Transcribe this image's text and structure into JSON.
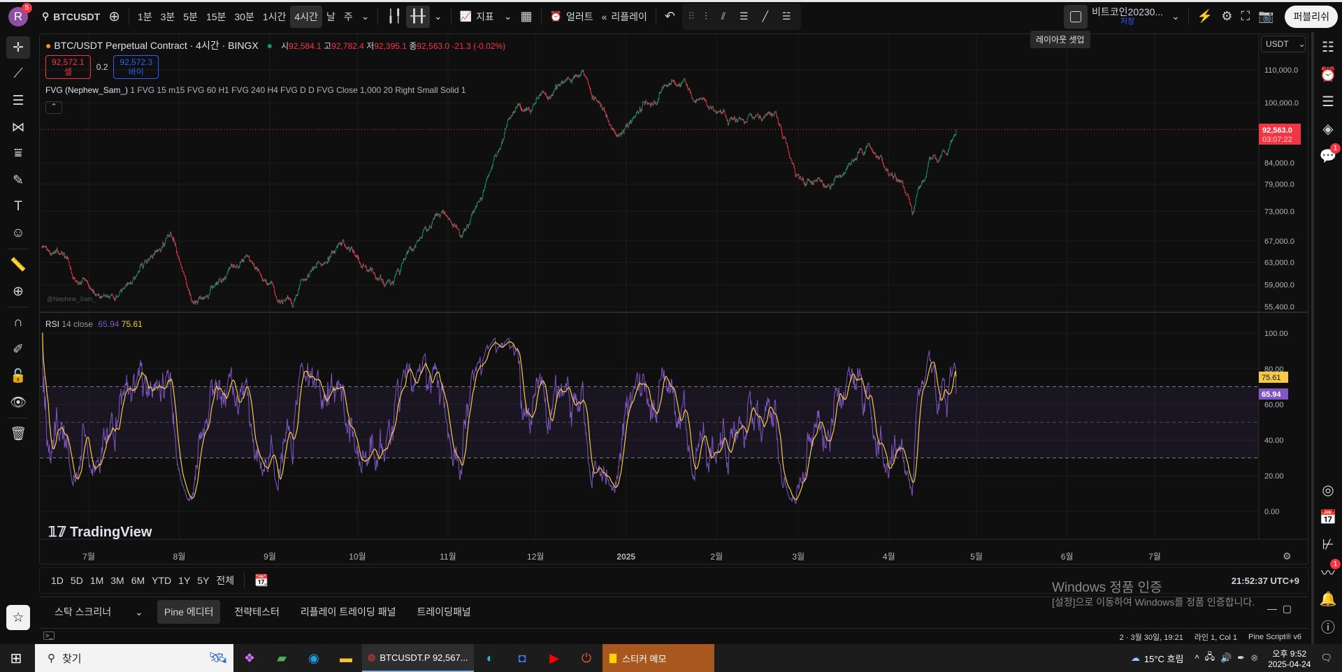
{
  "topbar": {
    "avatar_letter": "R",
    "avatar_badge": "5",
    "symbol": "BTCUSDT",
    "intervals": [
      "1분",
      "3분",
      "5분",
      "15분",
      "30분",
      "1시간",
      "4시간",
      "날",
      "주"
    ],
    "active_interval": "4시간",
    "indicators_label": "지표",
    "alert_label": "얼러트",
    "replay_label": "리플레이",
    "layout_name": "비트코인20230...",
    "layout_saved": "저장",
    "layout_tooltip": "레이아웃 셋업",
    "publish_label": "퍼블리쉬"
  },
  "legend": {
    "title": "BTC/USDT Perpetual Contract · 4시간 · BINGX",
    "open_label": "시",
    "open": "92,584.1",
    "high_label": "고",
    "high": "92,782.4",
    "low_label": "저",
    "low": "92,395.1",
    "close_label": "종",
    "close": "92,563.0",
    "change": "-21.3 (-0.02%)",
    "sell_price": "92,572.1",
    "sell_label": "셀",
    "spread": "0.2",
    "buy_price": "92,572.3",
    "buy_label": "바이",
    "indicator_name": "FVG (Nephew_Sam_)",
    "indicator_params": "1 FVG 15 m15 FVG 60 H1 FVG 240 H4 FVG D D FVG Close 1,000 20 Right Small Solid 1",
    "watermark_author": "@Nephew_Sam_",
    "rsi_name": "RSI",
    "rsi_params": "14 close",
    "rsi_value": "65.94",
    "rsi_ma_value": "75.61"
  },
  "price_axis": {
    "currency": "USDT",
    "last_price_label": "92,563.0",
    "countdown": "03:07:22"
  },
  "colors": {
    "up": "#089981",
    "down": "#f23645",
    "rsi": "#7e57c2",
    "rsi_ma": "#f7c948",
    "accent": "#2962ff"
  },
  "chart_data": {
    "type": "candlestick",
    "title": "BTC/USDT Perpetual Contract · 4시간 · BINGX",
    "price_scale": "log",
    "ylim": [
      55400,
      110000
    ],
    "price_ticks": [
      110000,
      100000,
      84000,
      79000,
      73000,
      67000,
      63000,
      59000,
      55400
    ],
    "price_tick_labels": [
      "110,000.0",
      "100,000.0",
      "84,000.0",
      "79,000.0",
      "73,000.0",
      "67,000.0",
      "63,000.0",
      "59,000.0",
      "55,400.0"
    ],
    "last_price": 92563.0,
    "approx_path": [
      [
        "2024-06-15",
        66000
      ],
      [
        "2024-07-06",
        55700
      ],
      [
        "2024-07-29",
        68800
      ],
      [
        "2024-08-06",
        55500
      ],
      [
        "2024-08-25",
        63900
      ],
      [
        "2024-09-06",
        55800
      ],
      [
        "2024-09-26",
        66000
      ],
      [
        "2024-10-11",
        60200
      ],
      [
        "2024-10-31",
        72300
      ],
      [
        "2024-11-06",
        68000
      ],
      [
        "2024-11-24",
        98600
      ],
      [
        "2024-12-17",
        107700
      ],
      [
        "2024-12-29",
        92700
      ],
      [
        "2025-01-21",
        107700
      ],
      [
        "2025-02-05",
        95200
      ],
      [
        "2025-02-21",
        97000
      ],
      [
        "2025-02-28",
        80000
      ],
      [
        "2025-03-11",
        78800
      ],
      [
        "2025-03-25",
        87200
      ],
      [
        "2025-04-09",
        75000
      ],
      [
        "2025-04-15",
        84800
      ],
      [
        "2025-04-21",
        85000
      ],
      [
        "2025-04-24",
        92563
      ]
    ],
    "x_ticks": [
      {
        "label": "7월",
        "date": "2024-07-01"
      },
      {
        "label": "8월",
        "date": "2024-08-01"
      },
      {
        "label": "9월",
        "date": "2024-09-01"
      },
      {
        "label": "10월",
        "date": "2024-10-01"
      },
      {
        "label": "11월",
        "date": "2024-11-01"
      },
      {
        "label": "12월",
        "date": "2024-12-01"
      },
      {
        "label": "2025",
        "date": "2025-01-01"
      },
      {
        "label": "2월",
        "date": "2025-02-01"
      },
      {
        "label": "3월",
        "date": "2025-03-01"
      },
      {
        "label": "4월",
        "date": "2025-04-01"
      },
      {
        "label": "5월",
        "date": "2025-05-01"
      },
      {
        "label": "6월",
        "date": "2025-06-01"
      },
      {
        "label": "7월",
        "date": "2025-07-01"
      }
    ],
    "rsi": {
      "length": 14,
      "source": "close",
      "ylim": [
        0,
        100
      ],
      "ticks": [
        100,
        80,
        60,
        40,
        20,
        0
      ],
      "tick_labels": [
        "100.00",
        "80.00",
        "60.00",
        "40.00",
        "20.00",
        "0.00"
      ],
      "bands": {
        "upper": 70,
        "middle": 50,
        "lower": 30
      },
      "last_rsi": 65.94,
      "last_ma": 75.61
    }
  },
  "range_bar": {
    "ranges": [
      "1D",
      "5D",
      "1M",
      "3M",
      "6M",
      "YTD",
      "1Y",
      "5Y",
      "전체"
    ],
    "clock": "21:52:37 UTC+9"
  },
  "bottom_panel": {
    "tabs": [
      "스탁 스크리너",
      "Pine 에디터",
      "전략테스터",
      "리플레이 트레이딩 패널",
      "트레이딩패널"
    ],
    "active_tab": "Pine 에디터",
    "status_position": "2 · 3월 30일, 19:21",
    "status_cursor": "라인 1, Col 1",
    "status_version": "Pine Script® v6"
  },
  "windows_watermark": {
    "title": "Windows 정품 인증",
    "subtitle": "[설정]으로 이동하여 Windows를 정품 인증합니다."
  },
  "right_sidebar": {
    "chat_badge": "1",
    "signal_badge": "1"
  },
  "logo": {
    "text": "TradingView"
  },
  "taskbar": {
    "search_placeholder": "찾기",
    "chrome_window": "BTCUSDT.P 92,567...",
    "sticky_notes": "스티커 메모",
    "weather": "15°C 흐림",
    "time": "오후 9:52",
    "date": "2025-04-24"
  }
}
